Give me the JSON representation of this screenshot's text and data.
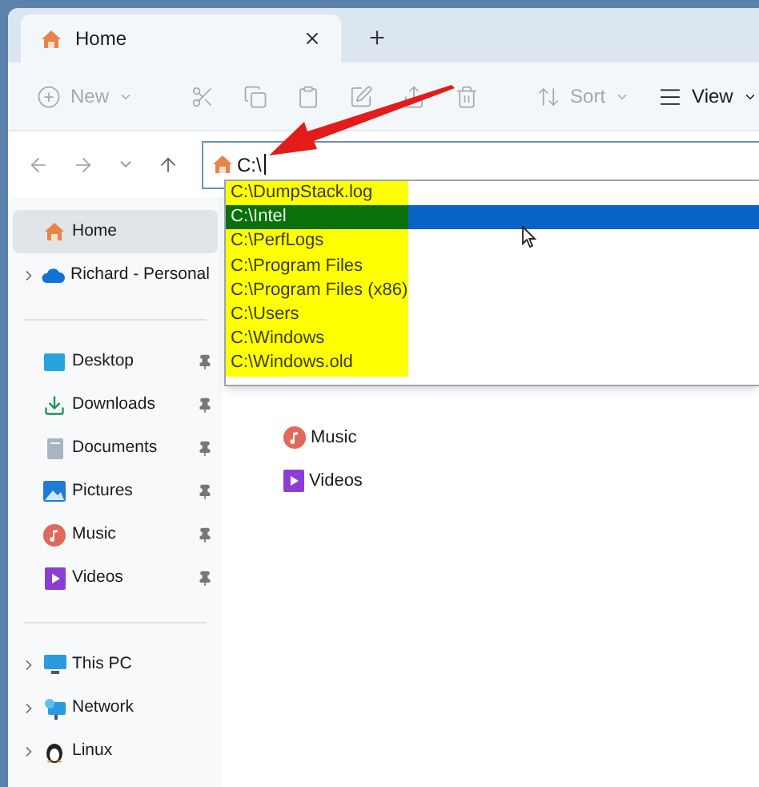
{
  "tabs": [
    {
      "label": "Home",
      "selected": true
    }
  ],
  "toolbar": [
    {
      "kind": "new",
      "label": "New",
      "disabled": true
    },
    {
      "kind": "cut",
      "disabled": true
    },
    {
      "kind": "copy",
      "disabled": true
    },
    {
      "kind": "paste",
      "disabled": true
    },
    {
      "kind": "rename",
      "disabled": true
    },
    {
      "kind": "share",
      "disabled": true
    },
    {
      "kind": "delete",
      "disabled": true
    },
    {
      "kind": "sort",
      "label": "Sort",
      "disabled": true
    },
    {
      "kind": "view",
      "label": "View",
      "disabled": false
    }
  ],
  "address": {
    "value": "C:\\"
  },
  "suggestions": [
    {
      "path": "C:\\DumpStack.log",
      "selected": false,
      "highlighted": true
    },
    {
      "path": "C:\\Intel",
      "selected": true,
      "highlighted": true
    },
    {
      "path": "C:\\PerfLogs",
      "selected": false,
      "highlighted": true
    },
    {
      "path": "C:\\Program Files",
      "selected": false,
      "highlighted": true
    },
    {
      "path": "C:\\Program Files (x86)",
      "selected": false,
      "highlighted": true
    },
    {
      "path": "C:\\Users",
      "selected": false,
      "highlighted": true
    },
    {
      "path": "C:\\Windows",
      "selected": false,
      "highlighted": true
    },
    {
      "path": "C:\\Windows.old",
      "selected": false,
      "highlighted": true
    }
  ],
  "sidebar": {
    "sections": [
      [
        {
          "kind": "home",
          "label": "Home",
          "selected": true,
          "expandable": false,
          "pinned": false
        },
        {
          "kind": "cloud",
          "label": "Richard - Personal",
          "selected": false,
          "expandable": true,
          "pinned": false
        }
      ],
      [
        {
          "kind": "desktop",
          "label": "Desktop",
          "selected": false,
          "expandable": false,
          "pinned": true
        },
        {
          "kind": "downloads",
          "label": "Downloads",
          "selected": false,
          "expandable": false,
          "pinned": true
        },
        {
          "kind": "documents",
          "label": "Documents",
          "selected": false,
          "expandable": false,
          "pinned": true
        },
        {
          "kind": "pictures",
          "label": "Pictures",
          "selected": false,
          "expandable": false,
          "pinned": true
        },
        {
          "kind": "music",
          "label": "Music",
          "selected": false,
          "expandable": false,
          "pinned": true
        },
        {
          "kind": "videos",
          "label": "Videos",
          "selected": false,
          "expandable": false,
          "pinned": true
        }
      ],
      [
        {
          "kind": "pc",
          "label": "This PC",
          "selected": false,
          "expandable": true,
          "pinned": false
        },
        {
          "kind": "network",
          "label": "Network",
          "selected": false,
          "expandable": true,
          "pinned": false
        },
        {
          "kind": "linux",
          "label": "Linux",
          "selected": false,
          "expandable": true,
          "pinned": false
        }
      ]
    ]
  },
  "content": [
    {
      "kind": "music",
      "label": "Music"
    },
    {
      "kind": "videos",
      "label": "Videos"
    }
  ]
}
